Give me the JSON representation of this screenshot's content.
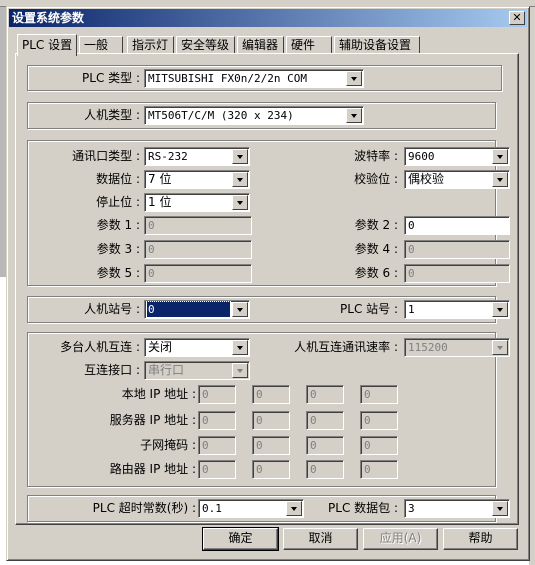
{
  "window": {
    "title": "设置系统参数",
    "close_label": "✕"
  },
  "tabs": [
    {
      "label": "PLC 设置",
      "active": true
    },
    {
      "label": "一般"
    },
    {
      "label": "指示灯"
    },
    {
      "label": "安全等级"
    },
    {
      "label": "编辑器"
    },
    {
      "label": "硬件"
    },
    {
      "label": "辅助设备设置"
    }
  ],
  "plc_type": {
    "label": "PLC 类型 :",
    "value": "MITSUBISHI FX0n/2/2n COM"
  },
  "hmi_type": {
    "label": "人机类型 :",
    "value": "MT506T/C/M (320 x 234)"
  },
  "comm": {
    "port_type": {
      "label": "通讯口类型 :",
      "value": "RS-232"
    },
    "baud_rate": {
      "label": "波特率 :",
      "value": "9600"
    },
    "data_bits": {
      "label": "数据位 :",
      "value": "7 位"
    },
    "parity": {
      "label": "校验位 :",
      "value": "偶校验"
    },
    "stop_bits": {
      "label": "停止位 :",
      "value": "1 位"
    },
    "param1": {
      "label": "参数 1 :",
      "value": "0"
    },
    "param2": {
      "label": "参数 2 :",
      "value": "0"
    },
    "param3": {
      "label": "参数 3 :",
      "value": "0"
    },
    "param4": {
      "label": "参数 4 :",
      "value": "0"
    },
    "param5": {
      "label": "参数 5 :",
      "value": "0"
    },
    "param6": {
      "label": "参数 6 :",
      "value": "0"
    }
  },
  "station": {
    "hmi_station": {
      "label": "人机站号 :",
      "value": "0"
    },
    "plc_station": {
      "label": "PLC 站号 :",
      "value": "1"
    }
  },
  "multi": {
    "multi_hmi": {
      "label": "多台人机互连 :",
      "value": "关闭"
    },
    "link_rate": {
      "label": "人机互连通讯速率 :",
      "value": "115200"
    },
    "link_port": {
      "label": "互连接口 :",
      "value": "串行口"
    },
    "local_ip": {
      "label": "本地 IP 地址 :",
      "values": [
        "0",
        "0",
        "0",
        "0"
      ]
    },
    "server_ip": {
      "label": "服务器 IP 地址 :",
      "values": [
        "0",
        "0",
        "0",
        "0"
      ]
    },
    "subnet": {
      "label": "子网掩码 :",
      "values": [
        "0",
        "0",
        "0",
        "0"
      ]
    },
    "router_ip": {
      "label": "路由器 IP 地址 :",
      "values": [
        "0",
        "0",
        "0",
        "0"
      ]
    }
  },
  "timeout": {
    "plc_timeout": {
      "label": "PLC 超时常数(秒) :",
      "value": "0.1"
    },
    "plc_packet": {
      "label": "PLC 数据包 :",
      "value": "3"
    }
  },
  "buttons": {
    "ok": "确定",
    "cancel": "取消",
    "apply": "应用(A)",
    "help": "帮助"
  }
}
